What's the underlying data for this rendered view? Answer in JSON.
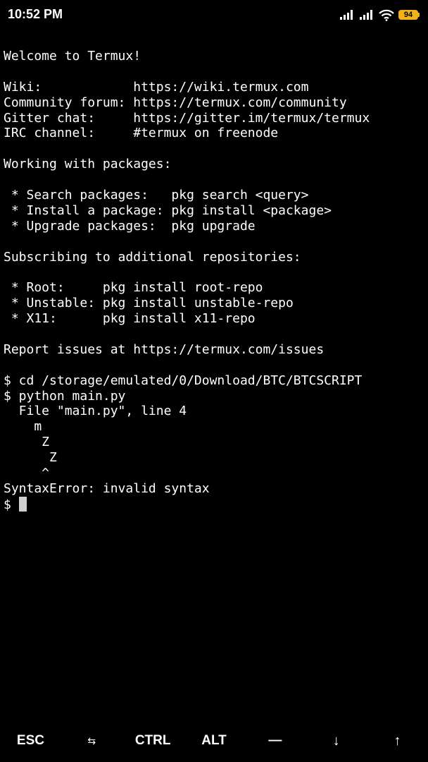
{
  "status_bar": {
    "time": "10:52 PM",
    "battery_level": "94",
    "icons": [
      "signal-icon",
      "signal-icon",
      "wifi-icon",
      "battery-icon"
    ]
  },
  "terminal": {
    "lines": [
      "Welcome to Termux!",
      "",
      "Wiki:            https://wiki.termux.com",
      "Community forum: https://termux.com/community",
      "Gitter chat:     https://gitter.im/termux/termux",
      "IRC channel:     #termux on freenode",
      "",
      "Working with packages:",
      "",
      " * Search packages:   pkg search <query>",
      " * Install a package: pkg install <package>",
      " * Upgrade packages:  pkg upgrade",
      "",
      "Subscribing to additional repositories:",
      "",
      " * Root:     pkg install root-repo",
      " * Unstable: pkg install unstable-repo",
      " * X11:      pkg install x11-repo",
      "",
      "Report issues at https://termux.com/issues",
      "",
      "$ cd /storage/emulated/0/Download/BTC/BTCSCRIPT",
      "$ python main.py",
      "  File \"main.py\", line 4",
      "    m",
      "     Z",
      "      Z",
      "     ^",
      "SyntaxError: invalid syntax"
    ],
    "prompt": "$ "
  },
  "extra_keys": {
    "esc": "ESC",
    "tab": "⇆",
    "ctrl": "CTRL",
    "alt": "ALT",
    "dash": "—",
    "down": "↓",
    "up": "↑"
  }
}
